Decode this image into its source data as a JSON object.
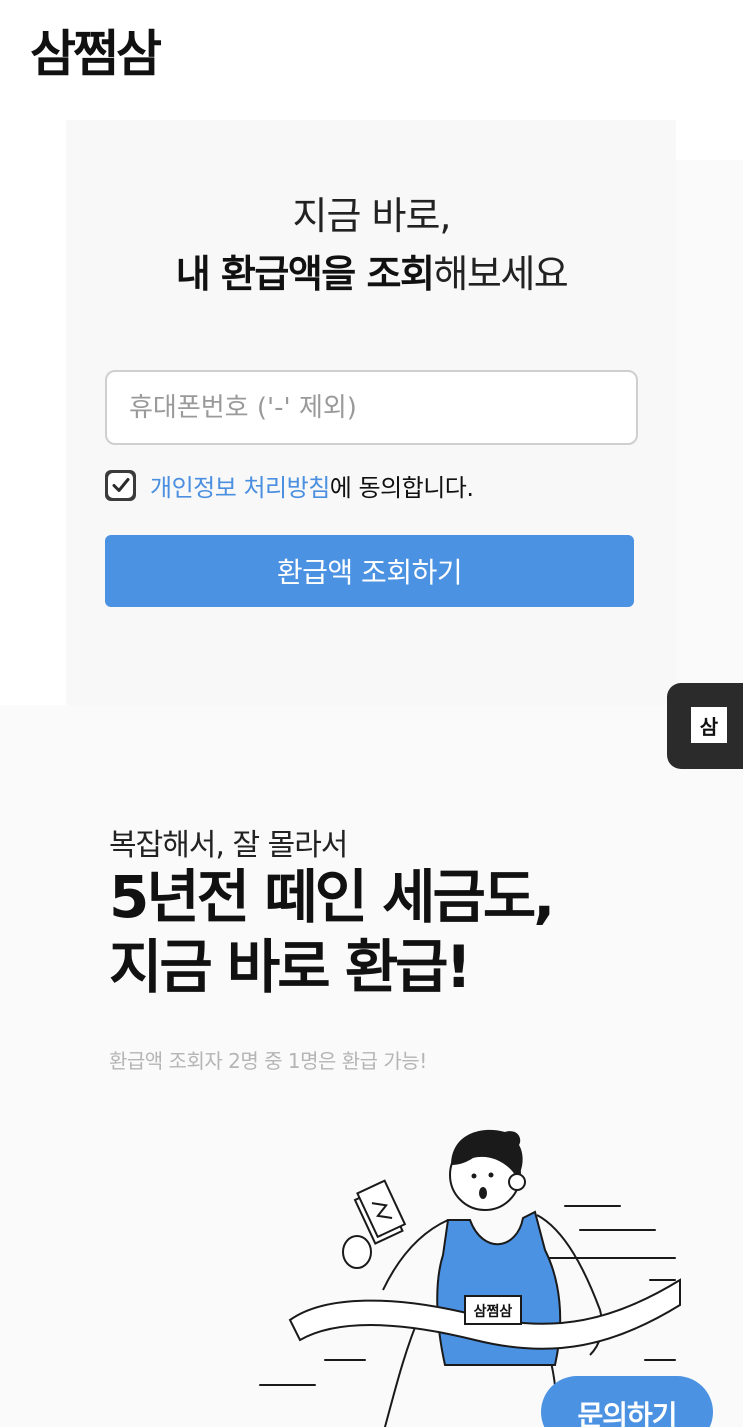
{
  "header": {
    "logo": "삼쩜삼"
  },
  "card": {
    "heading_line1": "지금 바로,",
    "heading_bold": "내 환급액을 조회",
    "heading_rest": "해보세요",
    "phone_placeholder": "휴대폰번호 ('-' 제외)",
    "agree_link": "개인정보 처리방침",
    "agree_suffix": "에 동의합니다.",
    "agree_checked": true,
    "submit_label": "환급액 조회하기"
  },
  "side_tab": {
    "mark": "삼"
  },
  "promo": {
    "kicker": "복잡해서, 잘 몰라서",
    "headline_line1": "5년전 떼인 세금도,",
    "headline_line2": "지금 바로 환급!",
    "note": "환급액 조회자 2명 중 1명은 환급 가능!"
  },
  "illustration": {
    "bib_text": "삼쩜삼"
  },
  "ask_button": {
    "label": "문의하기"
  },
  "colors": {
    "accent": "#4b92e3",
    "link": "#4a8fe0"
  }
}
